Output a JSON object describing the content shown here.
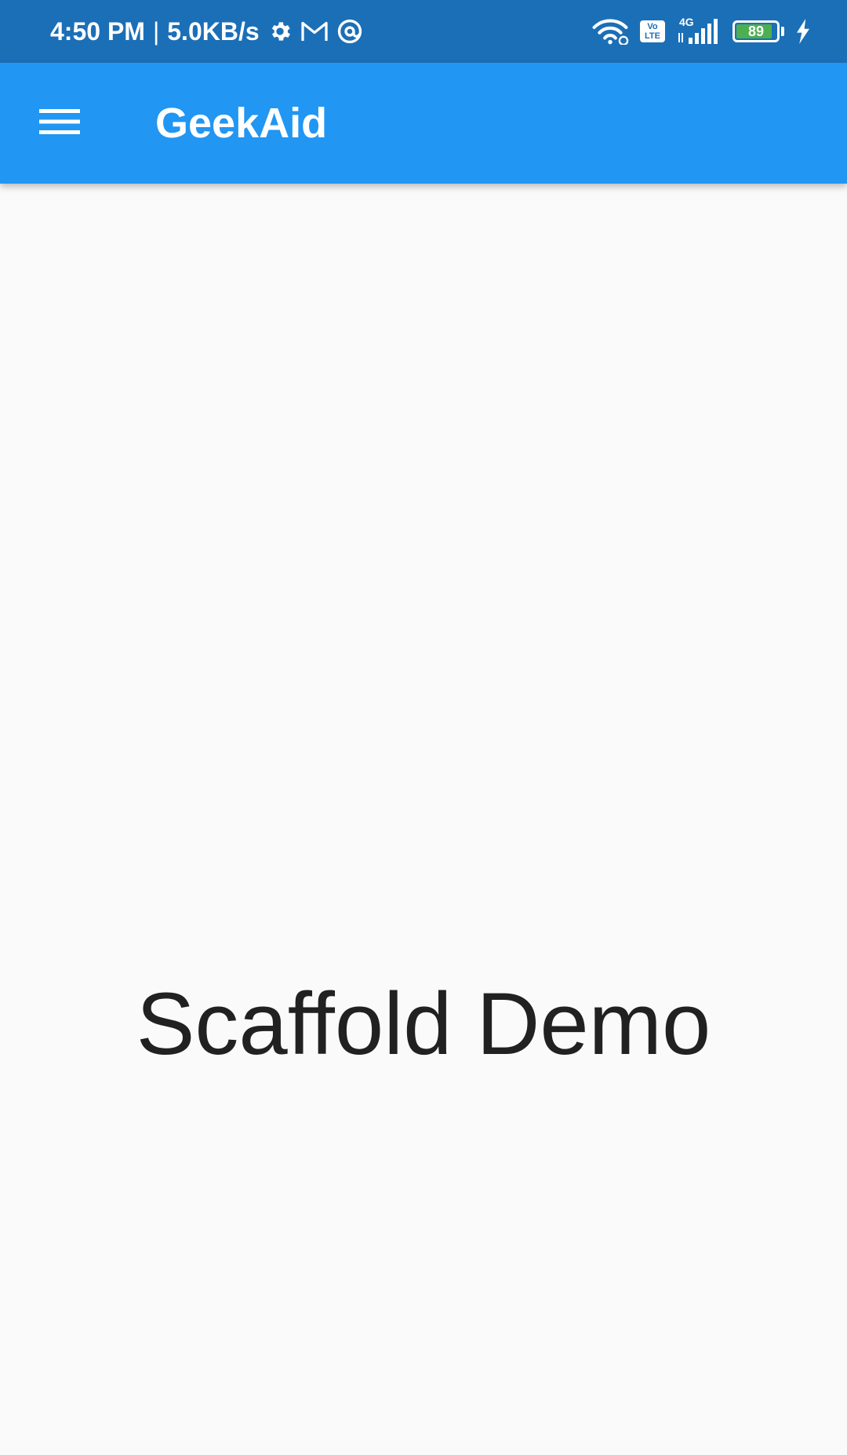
{
  "status_bar": {
    "time": "4:50 PM",
    "separator": "|",
    "speed": "5.0KB/s",
    "icons": [
      "gear-icon",
      "gmail-icon",
      "at-sign-icon",
      "wifi-icon",
      "volte-icon",
      "signal-icon",
      "battery-icon",
      "charging-icon"
    ],
    "volte_top": "Vo",
    "volte_bottom": "LTE",
    "network_type": "4G",
    "battery_level": "89",
    "background": "#1b6fb7"
  },
  "app_bar": {
    "menu_icon": "hamburger-menu-icon",
    "title": "GeekAid",
    "background": "#2196f3"
  },
  "body": {
    "text": "Scaffold Demo",
    "background": "#fafafa"
  }
}
